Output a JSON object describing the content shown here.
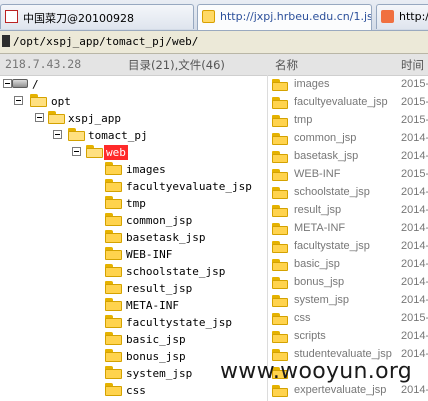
{
  "tabs": [
    {
      "label": "中国菜刀@20100928",
      "icon": "app-icon"
    },
    {
      "label": "http://jxpj.hrbeu.edu.cn/1.jsp",
      "icon": "folder-icon"
    },
    {
      "label": "http://",
      "icon": "page-icon"
    }
  ],
  "path": "/opt/xspj_app/tomact_pj/web/",
  "header": {
    "ip": "218.7.43.28",
    "count": "目录(21),文件(46)",
    "name_col": "名称",
    "time_col": "时间"
  },
  "tree": [
    {
      "label": "/",
      "icon": "drive-icon",
      "expanded": true
    },
    {
      "label": "opt",
      "expanded": true
    },
    {
      "label": "xspj_app",
      "expanded": true
    },
    {
      "label": "tomact_pj",
      "expanded": true
    },
    {
      "label": "web",
      "expanded": true,
      "selected": true
    },
    {
      "label": "images"
    },
    {
      "label": "facultyevaluate_jsp"
    },
    {
      "label": "tmp"
    },
    {
      "label": "common_jsp"
    },
    {
      "label": "basetask_jsp"
    },
    {
      "label": "WEB-INF"
    },
    {
      "label": "schoolstate_jsp"
    },
    {
      "label": "result_jsp"
    },
    {
      "label": "META-INF"
    },
    {
      "label": "facultystate_jsp"
    },
    {
      "label": "basic_jsp"
    },
    {
      "label": "bonus_jsp"
    },
    {
      "label": "system_jsp"
    },
    {
      "label": "css"
    }
  ],
  "files": [
    {
      "name": "images",
      "time": "2015-"
    },
    {
      "name": "facultyevaluate_jsp",
      "time": "2015-"
    },
    {
      "name": "tmp",
      "time": "2015-"
    },
    {
      "name": "common_jsp",
      "time": "2014-"
    },
    {
      "name": "basetask_jsp",
      "time": "2014-"
    },
    {
      "name": "WEB-INF",
      "time": "2015-"
    },
    {
      "name": "schoolstate_jsp",
      "time": "2014-"
    },
    {
      "name": "result_jsp",
      "time": "2014-"
    },
    {
      "name": "META-INF",
      "time": "2014-"
    },
    {
      "name": "facultystate_jsp",
      "time": "2014-"
    },
    {
      "name": "basic_jsp",
      "time": "2014-"
    },
    {
      "name": "bonus_jsp",
      "time": "2014-"
    },
    {
      "name": "system_jsp",
      "time": "2014-"
    },
    {
      "name": "css",
      "time": "2015-"
    },
    {
      "name": "scripts",
      "time": "2014-"
    },
    {
      "name": "studentevaluate_jsp",
      "time": "2014-"
    },
    {
      "name": "",
      "time": ""
    },
    {
      "name": "expertevaluate_jsp",
      "time": "2014-"
    }
  ],
  "watermark": "www.wooyun.org",
  "colors": {
    "selected": "#ff2a2a",
    "folder": "#ffd34d",
    "tab_active_text": "#2b4f9a"
  }
}
